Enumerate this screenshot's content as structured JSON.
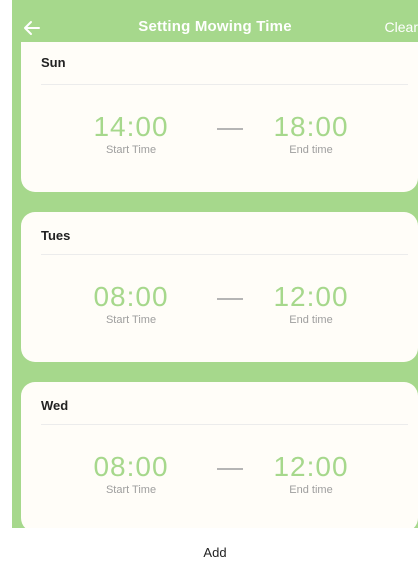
{
  "header": {
    "back_icon": "arrow-left-icon",
    "title": "Setting Mowing Time",
    "clear_label": "Clear"
  },
  "colors": {
    "accent": "#a6d88c",
    "card": "#fffdf8",
    "caption": "#9e9e9e"
  },
  "schedule": [
    {
      "day": "Sun",
      "start": "14:00",
      "start_label": "Start Time",
      "end": "18:00",
      "end_label": "End time"
    },
    {
      "day": "Tues",
      "start": "08:00",
      "start_label": "Start Time",
      "end": "12:00",
      "end_label": "End time"
    },
    {
      "day": "Wed",
      "start": "08:00",
      "start_label": "Start Time",
      "end": "12:00",
      "end_label": "End time"
    }
  ],
  "footer": {
    "add_label": "Add"
  }
}
